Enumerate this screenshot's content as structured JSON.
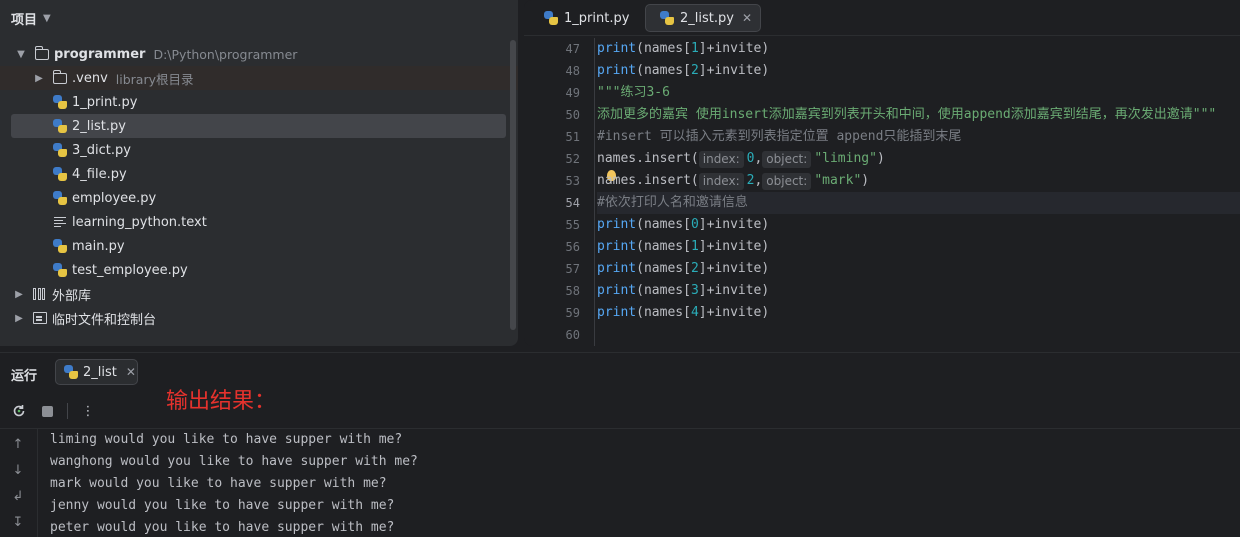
{
  "project_panel": {
    "title": "项目",
    "root": {
      "name": "programmer",
      "path": "D:\\Python\\programmer"
    },
    "venv": {
      "name": ".venv",
      "hint": "library根目录"
    },
    "files": [
      "1_print.py",
      "2_list.py",
      "3_dict.py",
      "4_file.py",
      "employee.py",
      "learning_python.text",
      "main.py",
      "test_employee.py"
    ],
    "selected_file": "2_list.py",
    "external_libs": "外部库",
    "scratches": "临时文件和控制台"
  },
  "editor": {
    "tabs": [
      {
        "label": "1_print.py",
        "active": false
      },
      {
        "label": "2_list.py",
        "active": true
      }
    ],
    "line_numbers": [
      "47",
      "48",
      "49",
      "50",
      "51",
      "52",
      "53",
      "54",
      "55",
      "56",
      "57",
      "58",
      "59",
      "60"
    ],
    "current_line": "54",
    "code": {
      "l47": {
        "fn": "print",
        "a": "(names[",
        "n": "1",
        "b": "]+invite)"
      },
      "l48": {
        "fn": "print",
        "a": "(names[",
        "n": "2",
        "b": "]+invite)"
      },
      "l49": "\"\"\"练习3-6",
      "l50": "添加更多的嘉宾 使用insert添加嘉宾到列表开头和中间，使用append添加嘉宾到结尾，再次发出邀请\"\"\"",
      "l51": "#insert 可以插入元素到列表指定位置 append只能插到末尾",
      "l52": {
        "pre": "names.insert(",
        "hint1": "index:",
        "n": "0",
        "sep": ",",
        "hint2": "object:",
        "s": "\"liming\"",
        "post": ")"
      },
      "l53": {
        "pre": "names.insert(",
        "hint1": "index:",
        "n": "2",
        "sep": ",",
        "hint2": "object:",
        "s": "\"mark\"",
        "post": ")"
      },
      "l54": "#依次打印人名和邀请信息",
      "l55": {
        "fn": "print",
        "a": "(names[",
        "n": "0",
        "b": "]+invite)"
      },
      "l56": {
        "fn": "print",
        "a": "(names[",
        "n": "1",
        "b": "]+invite)"
      },
      "l57": {
        "fn": "print",
        "a": "(names[",
        "n": "2",
        "b": "]+invite)"
      },
      "l58": {
        "fn": "print",
        "a": "(names[",
        "n": "3",
        "b": "]+invite)"
      },
      "l59": {
        "fn": "print",
        "a": "(names[",
        "n": "4",
        "b": "]+invite)"
      }
    }
  },
  "run_panel": {
    "label": "运行",
    "tab": "2_list",
    "annotation": "输出结果：",
    "output": [
      "liming would you like to have supper with me?",
      "wanghong would you like to have supper with me?",
      "mark would you like to have supper with me?",
      "jenny would you like to have supper with me?",
      "peter would you like to have supper with me?"
    ]
  },
  "icons": {
    "python_file": "python-file-icon",
    "folder": "folder-icon",
    "text_file": "text-file-icon",
    "library": "library-icon",
    "console": "console-icon",
    "rerun": "rerun-icon",
    "stop": "stop-icon",
    "more": "more-options-icon"
  },
  "colors": {
    "keyword_function": "#56a8f5",
    "number": "#2aacb8",
    "string": "#6aab73",
    "comment": "#7a7e85",
    "annotation": "#e5322d"
  }
}
